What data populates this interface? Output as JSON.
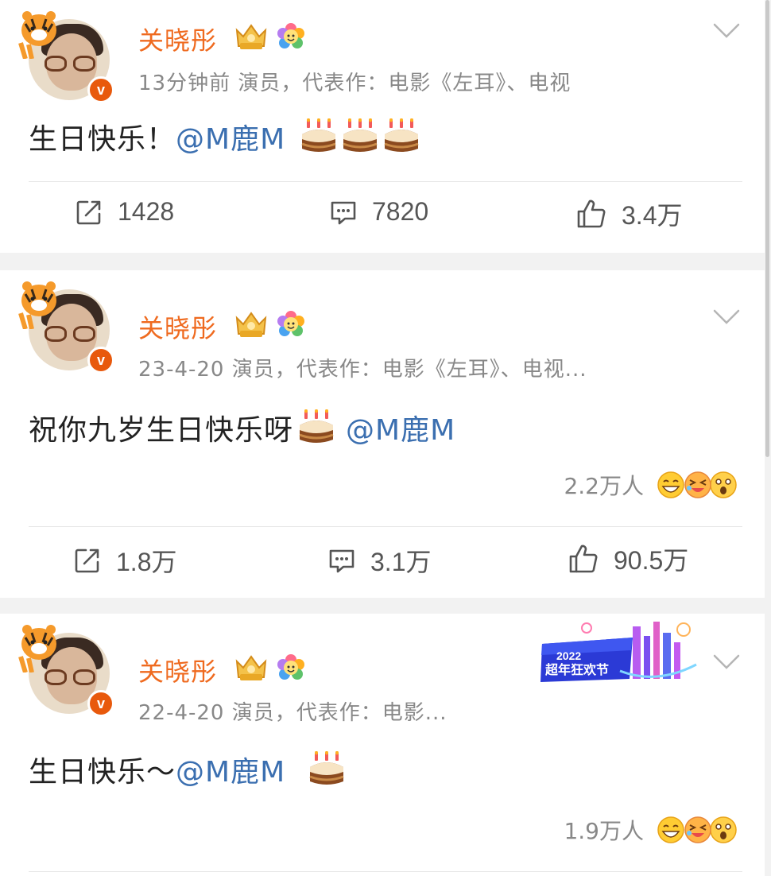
{
  "posts": [
    {
      "author": "关晓彤",
      "meta": "13分钟前  演员，代表作：电影《左耳》、电视",
      "text_plain": "生日快乐！",
      "mention": "@M鹿M",
      "cakes": 3,
      "reactions": null,
      "repost": "1428",
      "comments": "7820",
      "likes": "3.4万"
    },
    {
      "author": "关晓彤",
      "meta": "23-4-20  演员，代表作：电影《左耳》、电视...",
      "text_plain": "祝你九岁生日快乐呀",
      "mention": "@M鹿M",
      "cakes": 1,
      "reactions": "2.2万人",
      "repost": "1.8万",
      "comments": "3.1万",
      "likes": "90.5万"
    },
    {
      "author": "关晓彤",
      "meta": "22-4-20  演员，代表作：电影...",
      "text_plain": "生日快乐～",
      "mention": "@M鹿M",
      "cakes": 1,
      "reactions": "1.9万人",
      "banner": {
        "year": "2022",
        "title": "超年狂欢节"
      }
    }
  ],
  "colors": {
    "name": "#ef6a1f",
    "mention": "#3b6fb0",
    "meta": "#888888",
    "verified": "#e8590c"
  },
  "icons": [
    "repost-icon",
    "comment-icon",
    "like-icon",
    "chevron-down-icon",
    "cake-icon",
    "crown-badge-icon",
    "flower-badge-icon",
    "verified-icon"
  ]
}
